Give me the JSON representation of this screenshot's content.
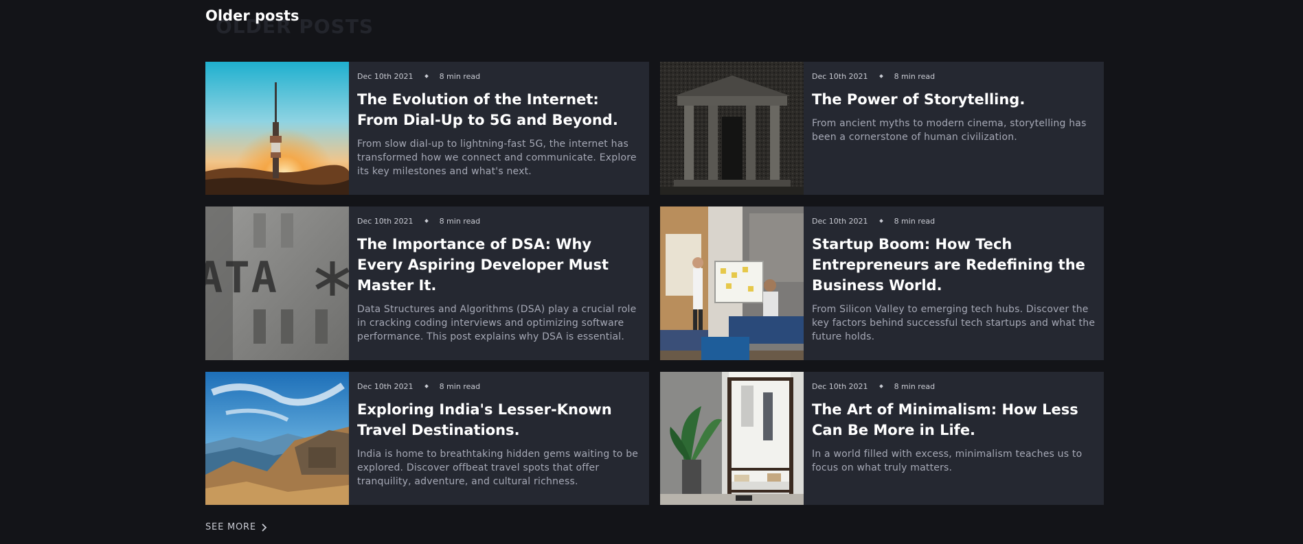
{
  "section": {
    "title": "Older posts",
    "ghost_title": "OLDER POSTS"
  },
  "posts": [
    {
      "date": "Dec 10th 2021",
      "read_time": "8 min read",
      "title": "The Evolution of the Internet: From Dial-Up to 5G and Beyond.",
      "excerpt": "From slow dial-up to lightning-fast 5G, the internet has transformed how we connect and communicate. Explore its key milestones and what's next."
    },
    {
      "date": "Dec 10th 2021",
      "read_time": "8 min read",
      "title": "The Power of Storytelling.",
      "excerpt": "From ancient myths to modern cinema, storytelling has been a cornerstone of human civilization."
    },
    {
      "date": "Dec 10th 2021",
      "read_time": "8 min read",
      "title": "The Importance of DSA: Why Every Aspiring Developer Must Master It.",
      "excerpt": "Data Structures and Algorithms (DSA) play a crucial role in cracking coding interviews and optimizing software performance. This post explains why DSA is essential."
    },
    {
      "date": "Dec 10th 2021",
      "read_time": "8 min read",
      "title": "Startup Boom: How Tech Entrepreneurs are Redefining the Business World.",
      "excerpt": "From Silicon Valley to emerging tech hubs. Discover the key factors behind successful tech startups and what the future holds."
    },
    {
      "date": "Dec 10th 2021",
      "read_time": "8 min read",
      "title": "Exploring India's Lesser-Known Travel Destinations.",
      "excerpt": "India is home to breathtaking hidden gems waiting to be explored. Discover offbeat travel spots that offer tranquility, adventure, and cultural richness."
    },
    {
      "date": "Dec 10th 2021",
      "read_time": "8 min read",
      "title": "The Art of Minimalism: How Less Can Be More in Life.",
      "excerpt": "In a world filled with excess, minimalism teaches us to focus on what truly matters."
    }
  ],
  "footer": {
    "see_more_label": "SEE MORE"
  },
  "colors": {
    "background": "#131418",
    "card": "#252831",
    "title": "#ffffff",
    "excerpt": "#a6a9b6"
  },
  "icons": {
    "see_more": "chevron-right-icon"
  }
}
